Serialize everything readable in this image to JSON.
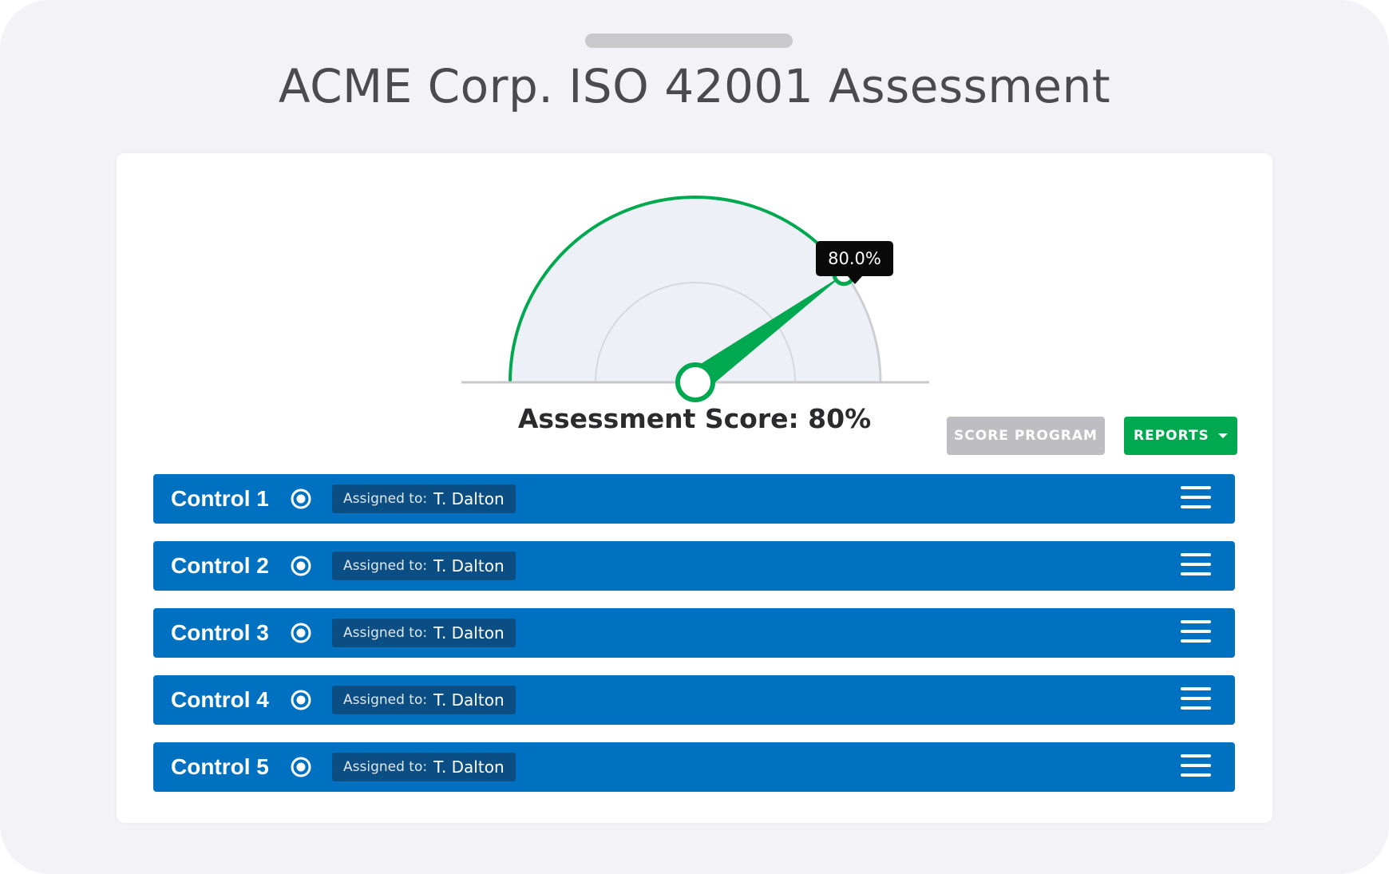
{
  "page": {
    "title": "ACME Corp. ISO 42001 Assessment"
  },
  "gauge": {
    "value_percent": 80,
    "tooltip": "80.0%",
    "score_label": "Assessment Score: 80%",
    "colors": {
      "accent": "#00a94f",
      "track_fill": "#eef0f7",
      "track_line": "#c8c8cc"
    }
  },
  "actions": {
    "score_program_label": "SCORE PROGRAM",
    "reports_label": "REPORTS",
    "reports_caret_icon": "caret-down-icon"
  },
  "controls": [
    {
      "name": "Control 1",
      "assigned_label": "Assigned to:",
      "assignee": "T. Dalton"
    },
    {
      "name": "Control 2",
      "assigned_label": "Assigned to:",
      "assignee": "T. Dalton"
    },
    {
      "name": "Control 3",
      "assigned_label": "Assigned to:",
      "assignee": "T. Dalton"
    },
    {
      "name": "Control 4",
      "assigned_label": "Assigned to:",
      "assignee": "T. Dalton"
    },
    {
      "name": "Control 5",
      "assigned_label": "Assigned to:",
      "assignee": "T. Dalton"
    }
  ],
  "colors": {
    "control_bar": "#0070c0",
    "assigned_badge": "#0b4e84",
    "score_button": "#bdbdc2",
    "reports_button": "#00a94f"
  }
}
